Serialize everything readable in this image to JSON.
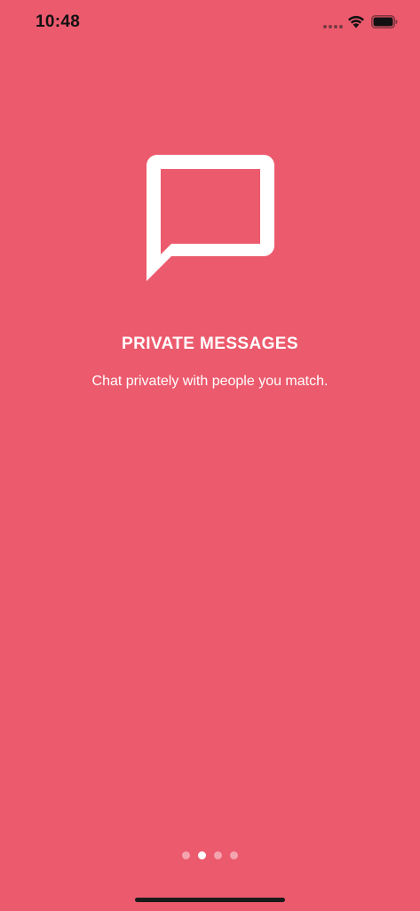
{
  "status_bar": {
    "time": "10:48",
    "icons": [
      "signal-icon",
      "wifi-icon",
      "battery-icon"
    ]
  },
  "onboarding": {
    "icon": "chat-bubble-icon",
    "title": "PRIVATE MESSAGES",
    "subtitle": "Chat privately with people you match."
  },
  "pagination": {
    "total_pages": 4,
    "current_page": 2
  },
  "colors": {
    "background": "#ec5a6d",
    "foreground": "#ffffff"
  }
}
